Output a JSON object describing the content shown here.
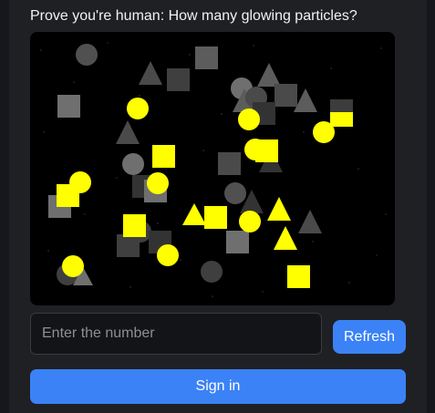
{
  "captcha": {
    "prompt": "Prove you're human: How many glowing particles?"
  },
  "answer": {
    "placeholder": "Enter the number",
    "value": ""
  },
  "actions": {
    "refresh_label": "Refresh",
    "signin_label": "Sign in"
  },
  "colors": {
    "accent": "#3b82f6",
    "glowing_particle": "#ffff00",
    "distractor_light": "#6f6f6f",
    "distractor_dark": "#3c3c3c",
    "canvas_background": "#000000"
  }
}
